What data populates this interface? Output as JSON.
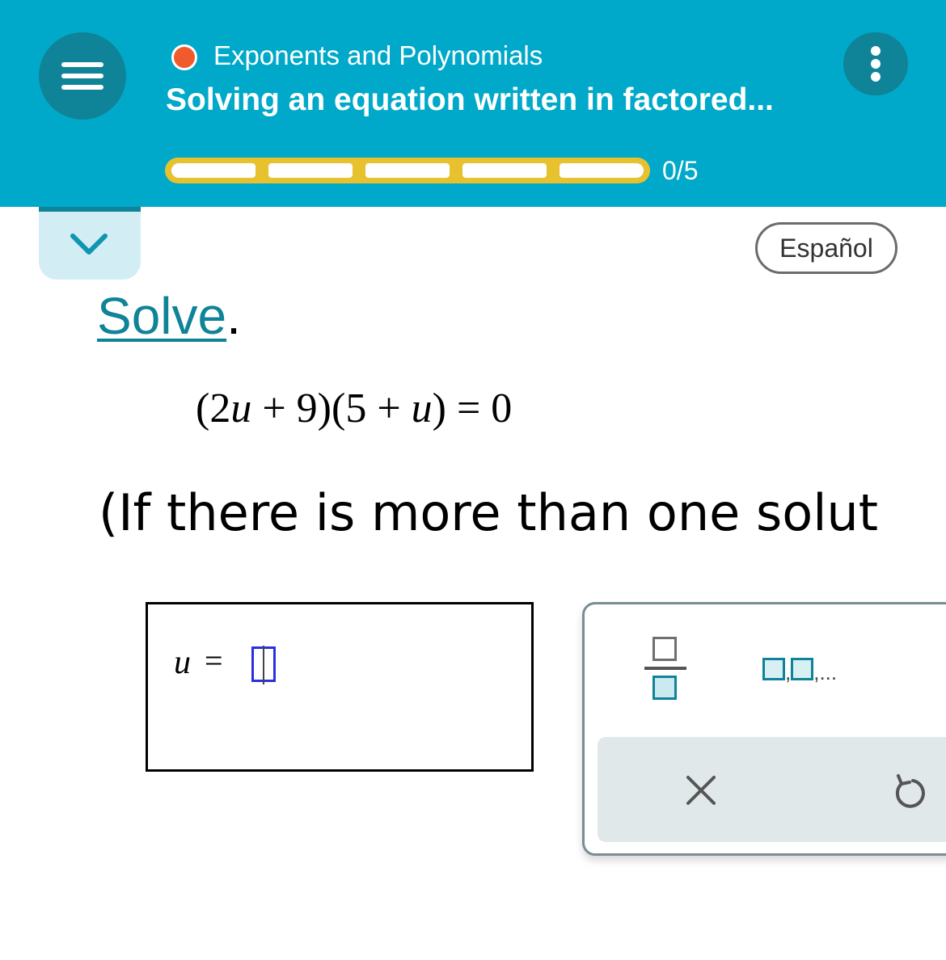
{
  "header": {
    "topic": "Exponents and Polynomials",
    "title": "Solving an equation written in factored...",
    "progress_label": "0/5",
    "progress_fraction": 0,
    "progress_segments": 5,
    "status_dot_color": "#f15a2b",
    "background_color": "#00a9c9"
  },
  "toolbar": {
    "menu_icon": "hamburger-icon",
    "more_icon": "vertical-dots-icon",
    "collapse_icon": "chevron-down-icon",
    "language_button": "Español"
  },
  "problem": {
    "instruction_link": "Solve",
    "instruction_punct": ".",
    "equation": {
      "open1": "(",
      "c1": "2",
      "var1": "u",
      "op1": " + 9",
      "close1": ")",
      "open2": "(",
      "c2": "5 + ",
      "var2": "u",
      "close2": ")",
      "rhs": " = 0"
    },
    "hint": "(If there is more than one solut"
  },
  "answer": {
    "variable": "u",
    "equals": "=",
    "value": ""
  },
  "keypad": {
    "fraction_key": "fraction-icon",
    "list_separator_1": ",",
    "list_separator_2": ",...",
    "clear_icon": "close-icon",
    "undo_icon": "undo-icon"
  }
}
